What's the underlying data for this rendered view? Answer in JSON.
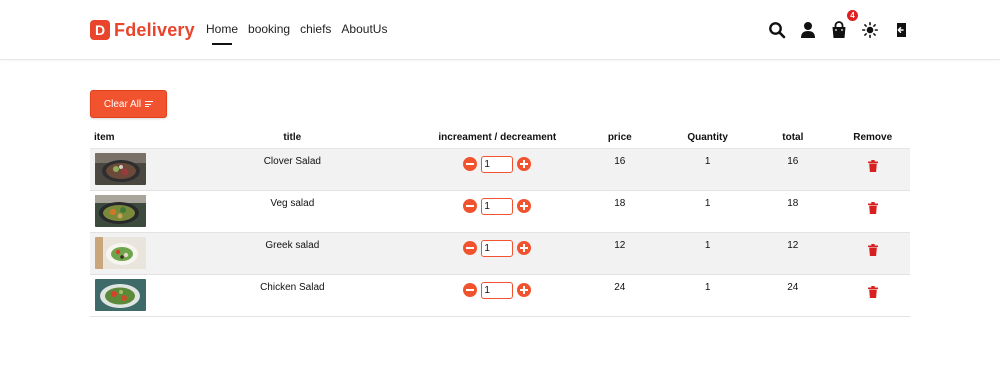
{
  "brand": {
    "logo_letter": "D",
    "name": "Fdelivery",
    "accent": "#e8452c"
  },
  "nav": {
    "links": [
      {
        "label": "Home",
        "active": true
      },
      {
        "label": "booking",
        "active": false
      },
      {
        "label": "chiefs",
        "active": false
      },
      {
        "label": "AboutUs",
        "active": false
      }
    ],
    "icons": [
      "search-icon",
      "user-icon",
      "shopping-bag-icon",
      "sun-icon",
      "logout-icon"
    ],
    "cart_count": "4"
  },
  "clear_button": {
    "label": "Clear All"
  },
  "table": {
    "headers": {
      "item": "item",
      "title": "title",
      "inc_dec": "increament / decreament",
      "price": "price",
      "quantity": "Quantity",
      "total": "total",
      "remove": "Remove"
    },
    "rows": [
      {
        "title": "Clover Salad",
        "qty_value": "1",
        "price": "16",
        "quantity": "1",
        "total": "16"
      },
      {
        "title": "Veg salad",
        "qty_value": "1",
        "price": "18",
        "quantity": "1",
        "total": "18"
      },
      {
        "title": "Greek salad",
        "qty_value": "1",
        "price": "12",
        "quantity": "1",
        "total": "12"
      },
      {
        "title": "Chicken Salad",
        "qty_value": "1",
        "price": "24",
        "quantity": "1",
        "total": "24"
      }
    ]
  },
  "colors": {
    "accent": "#f2532f",
    "danger": "#d92020",
    "row_stripe": "#f2f2f2"
  }
}
